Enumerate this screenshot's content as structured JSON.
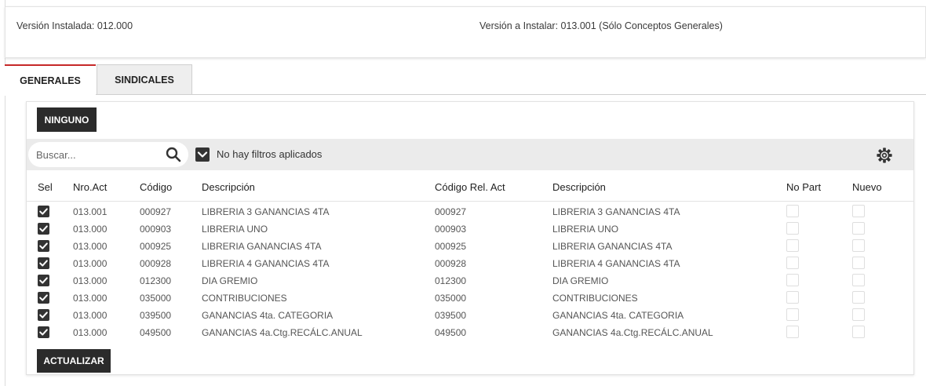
{
  "version": {
    "installed_label": "Versión Instalada: 012.000",
    "to_install_label": "Versión a Instalar: 013.001  (Sólo Conceptos Generales)"
  },
  "tabs": [
    {
      "label": "GENERALES",
      "active": true
    },
    {
      "label": "SINDICALES",
      "active": false
    }
  ],
  "toolbar": {
    "ninguno_label": "NINGUNO",
    "actualizar_label": "ACTUALIZAR"
  },
  "search": {
    "placeholder": "Buscar...",
    "value": ""
  },
  "filters": {
    "status_text": "No hay filtros aplicados"
  },
  "icons": {
    "search": "search-icon",
    "filter_toggle": "chevron-down-icon",
    "settings": "gear-icon"
  },
  "colors": {
    "active_tab_accent": "#c62828",
    "button_bg": "#2b2b2b",
    "checkbox_bg": "#333333",
    "filter_bar_bg": "#ebebeb"
  },
  "table": {
    "columns": [
      "Sel",
      "Nro.Act",
      "Código",
      "Descripción",
      "Código Rel. Act",
      "Descripción",
      "No Part",
      "Nuevo"
    ],
    "rows": [
      {
        "sel": true,
        "nro": "013.001",
        "codigo": "000927",
        "desc": "LIBRERIA 3 GANANCIAS 4TA",
        "codrel": "000927",
        "desc2": "LIBRERIA 3 GANANCIAS 4TA",
        "nopart": false,
        "nuevo": false
      },
      {
        "sel": true,
        "nro": "013.000",
        "codigo": "000903",
        "desc": "LIBRERIA UNO",
        "codrel": "000903",
        "desc2": "LIBRERIA UNO",
        "nopart": false,
        "nuevo": false
      },
      {
        "sel": true,
        "nro": "013.000",
        "codigo": "000925",
        "desc": "LIBRERIA GANANCIAS 4TA",
        "codrel": "000925",
        "desc2": "LIBRERIA GANANCIAS 4TA",
        "nopart": false,
        "nuevo": false
      },
      {
        "sel": true,
        "nro": "013.000",
        "codigo": "000928",
        "desc": "LIBRERIA 4 GANANCIAS 4TA",
        "codrel": "000928",
        "desc2": "LIBRERIA 4 GANANCIAS 4TA",
        "nopart": false,
        "nuevo": false
      },
      {
        "sel": true,
        "nro": "013.000",
        "codigo": "012300",
        "desc": "DIA GREMIO",
        "codrel": "012300",
        "desc2": "DIA GREMIO",
        "nopart": false,
        "nuevo": false
      },
      {
        "sel": true,
        "nro": "013.000",
        "codigo": "035000",
        "desc": "CONTRIBUCIONES",
        "codrel": "035000",
        "desc2": "CONTRIBUCIONES",
        "nopart": false,
        "nuevo": false
      },
      {
        "sel": true,
        "nro": "013.000",
        "codigo": "039500",
        "desc": "GANANCIAS 4ta. CATEGORIA",
        "codrel": "039500",
        "desc2": "GANANCIAS 4ta. CATEGORIA",
        "nopart": false,
        "nuevo": false
      },
      {
        "sel": true,
        "nro": "013.000",
        "codigo": "049500",
        "desc": "GANANCIAS 4a.Ctg.RECÁLC.ANUAL",
        "codrel": "049500",
        "desc2": "GANANCIAS 4a.Ctg.RECÁLC.ANUAL",
        "nopart": false,
        "nuevo": false
      }
    ]
  }
}
